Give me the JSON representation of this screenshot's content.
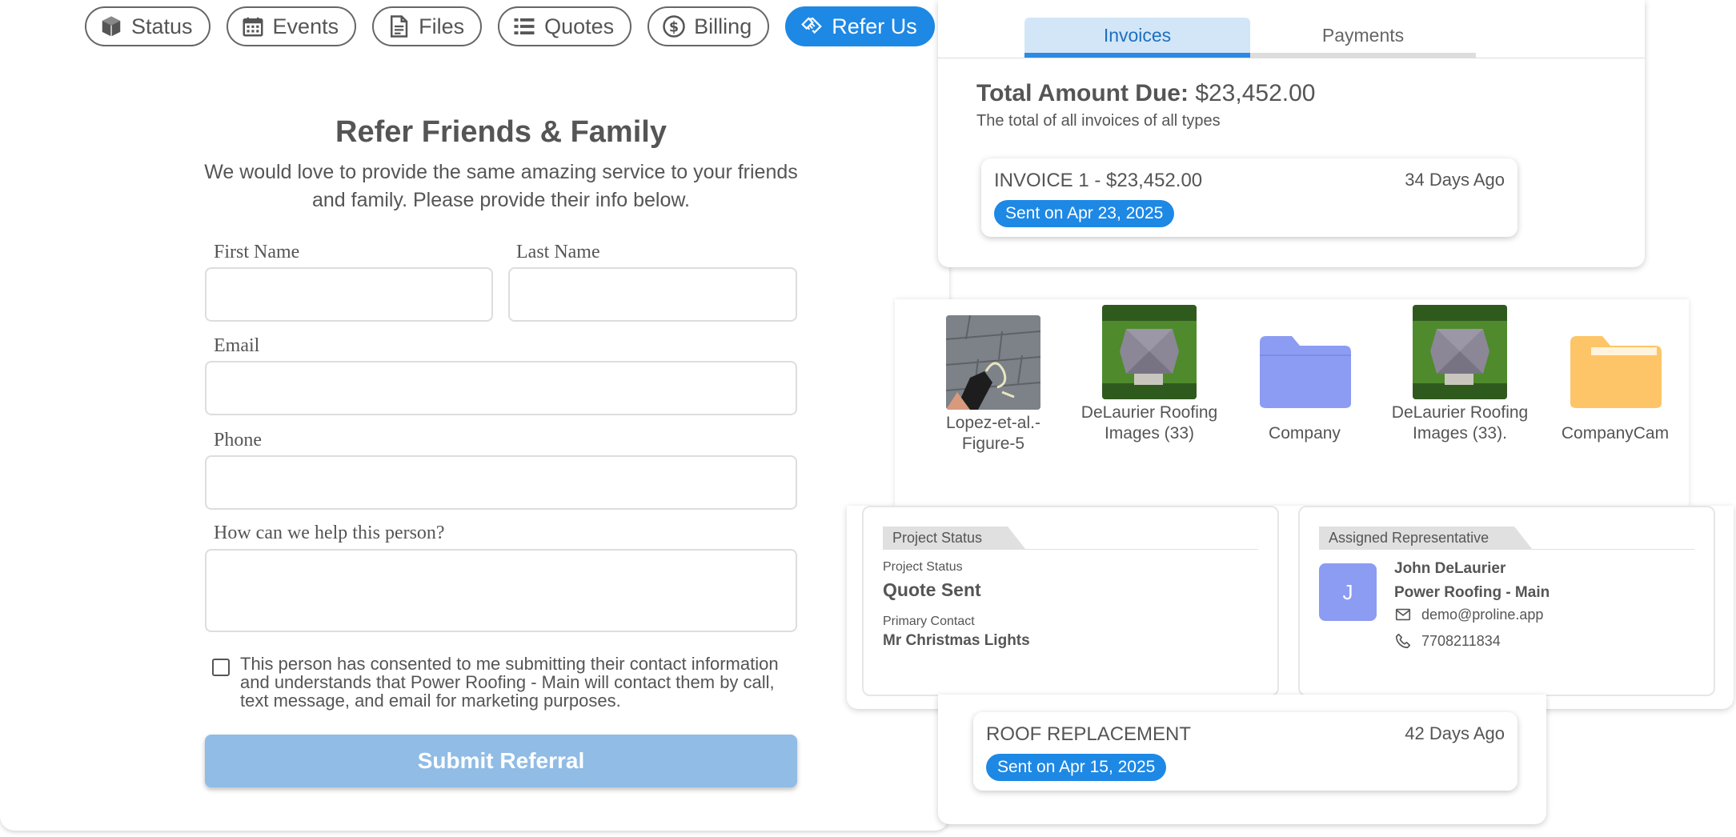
{
  "nav": {
    "tabs": [
      {
        "label": "Status",
        "icon": "cube-icon"
      },
      {
        "label": "Events",
        "icon": "calendar-icon"
      },
      {
        "label": "Files",
        "icon": "file-icon"
      },
      {
        "label": "Quotes",
        "icon": "list-icon"
      },
      {
        "label": "Billing",
        "icon": "dollar-icon"
      },
      {
        "label": "Refer Us",
        "icon": "handshake-icon"
      }
    ],
    "active": "Refer Us"
  },
  "referral_form": {
    "title": "Refer Friends & Family",
    "subtitle": "We would love to provide the same amazing service to your friends and family. Please provide their info below.",
    "first_name_label": "First Name",
    "last_name_label": "Last Name",
    "email_label": "Email",
    "phone_label": "Phone",
    "help_label": "How can we help this person?",
    "consent_text": "This person has consented to me submitting their contact information and understands that Power Roofing - Main will contact them by call, text message, and email for marketing purposes.",
    "submit_label": "Submit Referral"
  },
  "billing": {
    "tabs": [
      "Invoices",
      "Payments"
    ],
    "active_tab": "Invoices",
    "total_label": "Total Amount Due:",
    "total_value": "$23,452.00",
    "total_description": "The total of all invoices of all types",
    "invoice": {
      "name": "INVOICE 1 - $23,452.00",
      "age": "34 Days Ago",
      "sent": "Sent on Apr 23, 2025"
    }
  },
  "files": [
    {
      "name": "Lopez-et-al.-Figure-5",
      "kind": "photo-shingles"
    },
    {
      "name": "DeLaurier Roofing Images (33)",
      "kind": "photo-aerial"
    },
    {
      "name": "Company",
      "kind": "folder-blue"
    },
    {
      "name": "DeLaurier Roofing Images (33).",
      "kind": "photo-aerial"
    },
    {
      "name": "CompanyCam",
      "kind": "folder-yellow"
    }
  ],
  "project_status": {
    "header": "Project Status",
    "status_label": "Project Status",
    "status_value": "Quote Sent",
    "contact_label": "Primary Contact",
    "contact_value": "Mr Christmas Lights"
  },
  "representative": {
    "header": "Assigned Representative",
    "initial": "J",
    "name": "John DeLaurier",
    "company": "Power Roofing - Main",
    "email": "demo@proline.app",
    "phone": "7708211834",
    "avatar_color": "#8c9cf2"
  },
  "quote": {
    "name": "ROOF REPLACEMENT",
    "age": "42 Days Ago",
    "sent": "Sent on Apr 15, 2025"
  },
  "colors": {
    "accent": "#1e88e5",
    "submit_disabled": "#90bce6",
    "folder_blue": "#8c9cf2",
    "folder_yellow": "#fdc567"
  }
}
